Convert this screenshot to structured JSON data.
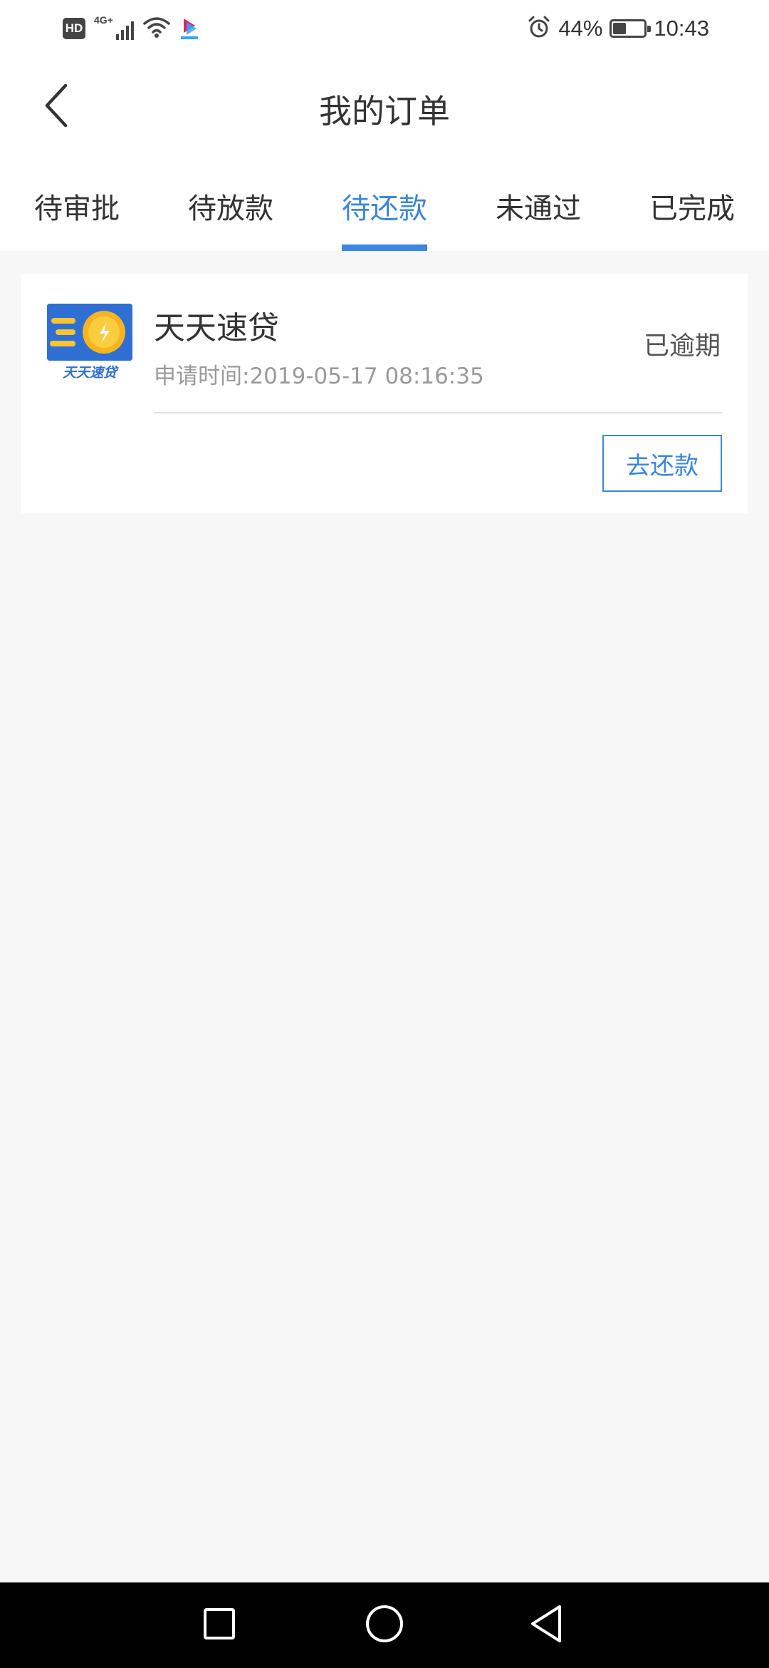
{
  "status_bar": {
    "hd_label": "HD",
    "network_label": "4G+",
    "battery_percent": "44%",
    "battery_level": 0.44,
    "time": "10:43",
    "icons": [
      "signal-icon",
      "wifi-icon",
      "youku-icon",
      "alarm-icon",
      "battery-icon"
    ]
  },
  "header": {
    "title": "我的订单",
    "back_icon": "chevron-left-icon"
  },
  "tabs": [
    {
      "label": "待审批",
      "active": false
    },
    {
      "label": "待放款",
      "active": false
    },
    {
      "label": "待还款",
      "active": true
    },
    {
      "label": "未通过",
      "active": false
    },
    {
      "label": "已完成",
      "active": false
    }
  ],
  "orders": [
    {
      "logo_text": "天天速贷",
      "name": "天天速贷",
      "apply_time": "申请时间:2019-05-17 08:16:35",
      "status": "已逾期",
      "action_label": "去还款"
    }
  ],
  "nav_bar": {
    "icons": [
      "recents-square-icon",
      "home-circle-icon",
      "back-triangle-icon"
    ]
  },
  "colors": {
    "accent": "#3b86df",
    "background": "#f7f7f7",
    "card": "#ffffff",
    "text_primary": "#333333",
    "text_secondary": "#9a9a9a"
  }
}
